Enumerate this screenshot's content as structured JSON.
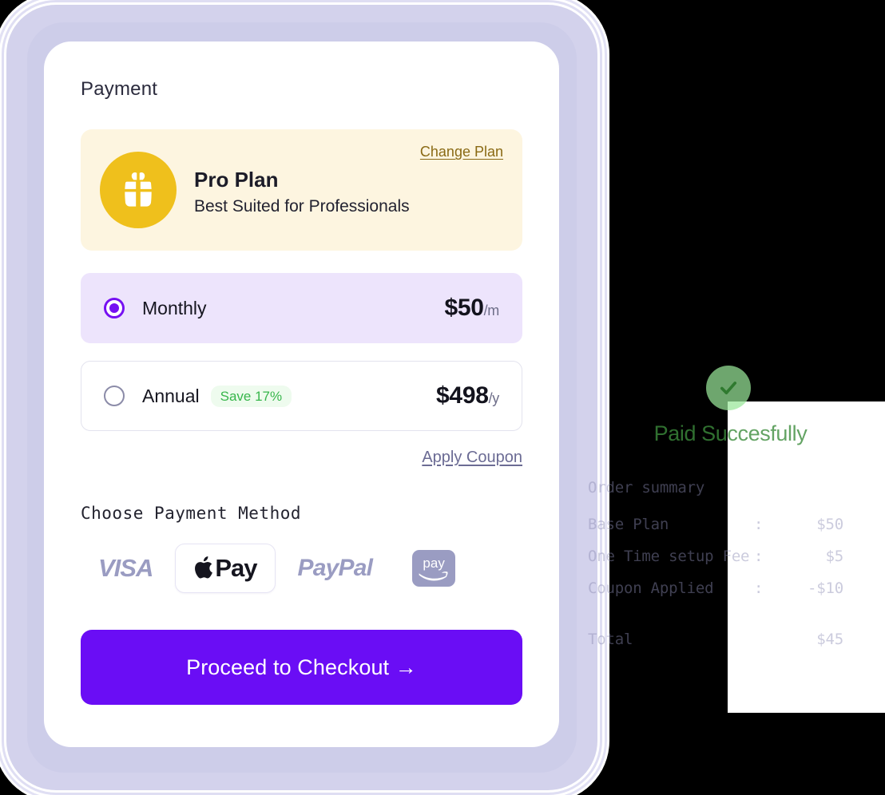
{
  "page": {
    "title": "Payment"
  },
  "plan": {
    "icon": "gift-icon",
    "name": "Pro Plan",
    "subtitle": "Best Suited for Professionals",
    "change_plan_label": "Change Plan",
    "card_bg": "#FDF5E0",
    "badge_color": "#EFC01C",
    "link_color": "#8A6A14"
  },
  "billing_options": [
    {
      "id": "monthly",
      "label": "Monthly",
      "price": "$50",
      "period": "/m",
      "badge": null,
      "selected": true
    },
    {
      "id": "annual",
      "label": "Annual",
      "price": "$498",
      "period": "/y",
      "badge": "Save 17%",
      "selected": false
    }
  ],
  "coupon": {
    "apply_label": "Apply Coupon"
  },
  "payment_method": {
    "title": "Choose Payment Method",
    "options": [
      {
        "id": "visa",
        "label": "VISA",
        "selected": false
      },
      {
        "id": "apple-pay",
        "label": "Pay",
        "selected": true
      },
      {
        "id": "paypal",
        "label": "PayPal",
        "selected": false
      },
      {
        "id": "amazon-pay",
        "label": "pay",
        "selected": false
      }
    ]
  },
  "checkout": {
    "label": "Proceed to Checkout →",
    "color": "#6A0DF5"
  },
  "receipt": {
    "status_icon": "check-circle-icon",
    "status_text": "Paid Succesfully",
    "status_color": "#3C8C3C",
    "summary_title": "Order summary",
    "separator": ":",
    "rows": [
      {
        "label": "Base Plan",
        "value": "$50"
      },
      {
        "label": "One Time setup Fee",
        "value": "$5"
      },
      {
        "label": "Coupon Applied",
        "value": "-$10"
      }
    ],
    "total_label": "Total",
    "total_value": "$45"
  }
}
